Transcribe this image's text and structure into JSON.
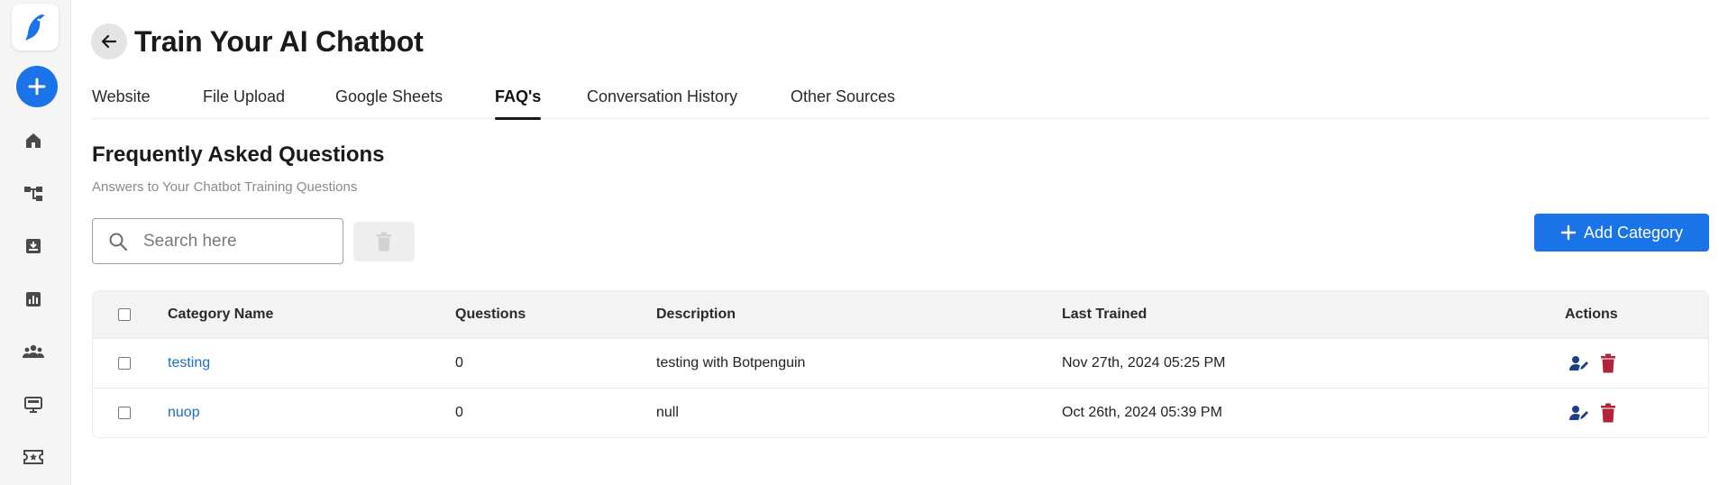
{
  "sidebar": {
    "logo_icon": "penguin-logo-icon",
    "items": [
      {
        "name": "home",
        "icon": "home-icon"
      },
      {
        "name": "flows",
        "icon": "hierarchy-icon"
      },
      {
        "name": "inbox",
        "icon": "inbox-download-icon"
      },
      {
        "name": "analytics",
        "icon": "bar-chart-icon"
      },
      {
        "name": "contacts",
        "icon": "people-group-icon"
      },
      {
        "name": "desktop",
        "icon": "monitor-icon"
      },
      {
        "name": "tickets",
        "icon": "star-ticket-icon"
      }
    ],
    "accent_color": "#1a73e8"
  },
  "header": {
    "title": "Train Your AI Chatbot"
  },
  "tabs": [
    {
      "label": "Website",
      "active": false
    },
    {
      "label": "File Upload",
      "active": false
    },
    {
      "label": "Google Sheets",
      "active": false
    },
    {
      "label": "FAQ's",
      "active": true
    },
    {
      "label": "Conversation History",
      "active": false
    },
    {
      "label": "Other Sources",
      "active": false
    }
  ],
  "section": {
    "title": "Frequently Asked Questions",
    "subtitle": "Answers to Your Chatbot Training Questions"
  },
  "search": {
    "placeholder": "Search here",
    "value": ""
  },
  "buttons": {
    "add_category": "Add Category"
  },
  "table": {
    "columns": [
      "Category Name",
      "Questions",
      "Description",
      "Last Trained",
      "Actions"
    ],
    "rows": [
      {
        "name": "testing",
        "questions": "0",
        "description": "testing with Botpenguin",
        "last_trained": "Nov 27th, 2024 05:25 PM"
      },
      {
        "name": "nuop",
        "questions": "0",
        "description": "null",
        "last_trained": "Oct 26th, 2024 05:39 PM"
      }
    ]
  },
  "colors": {
    "primary": "#1a73e8",
    "edit_icon": "#1d3f8a",
    "delete_icon": "#b3243a",
    "link": "#1a6fc2"
  }
}
